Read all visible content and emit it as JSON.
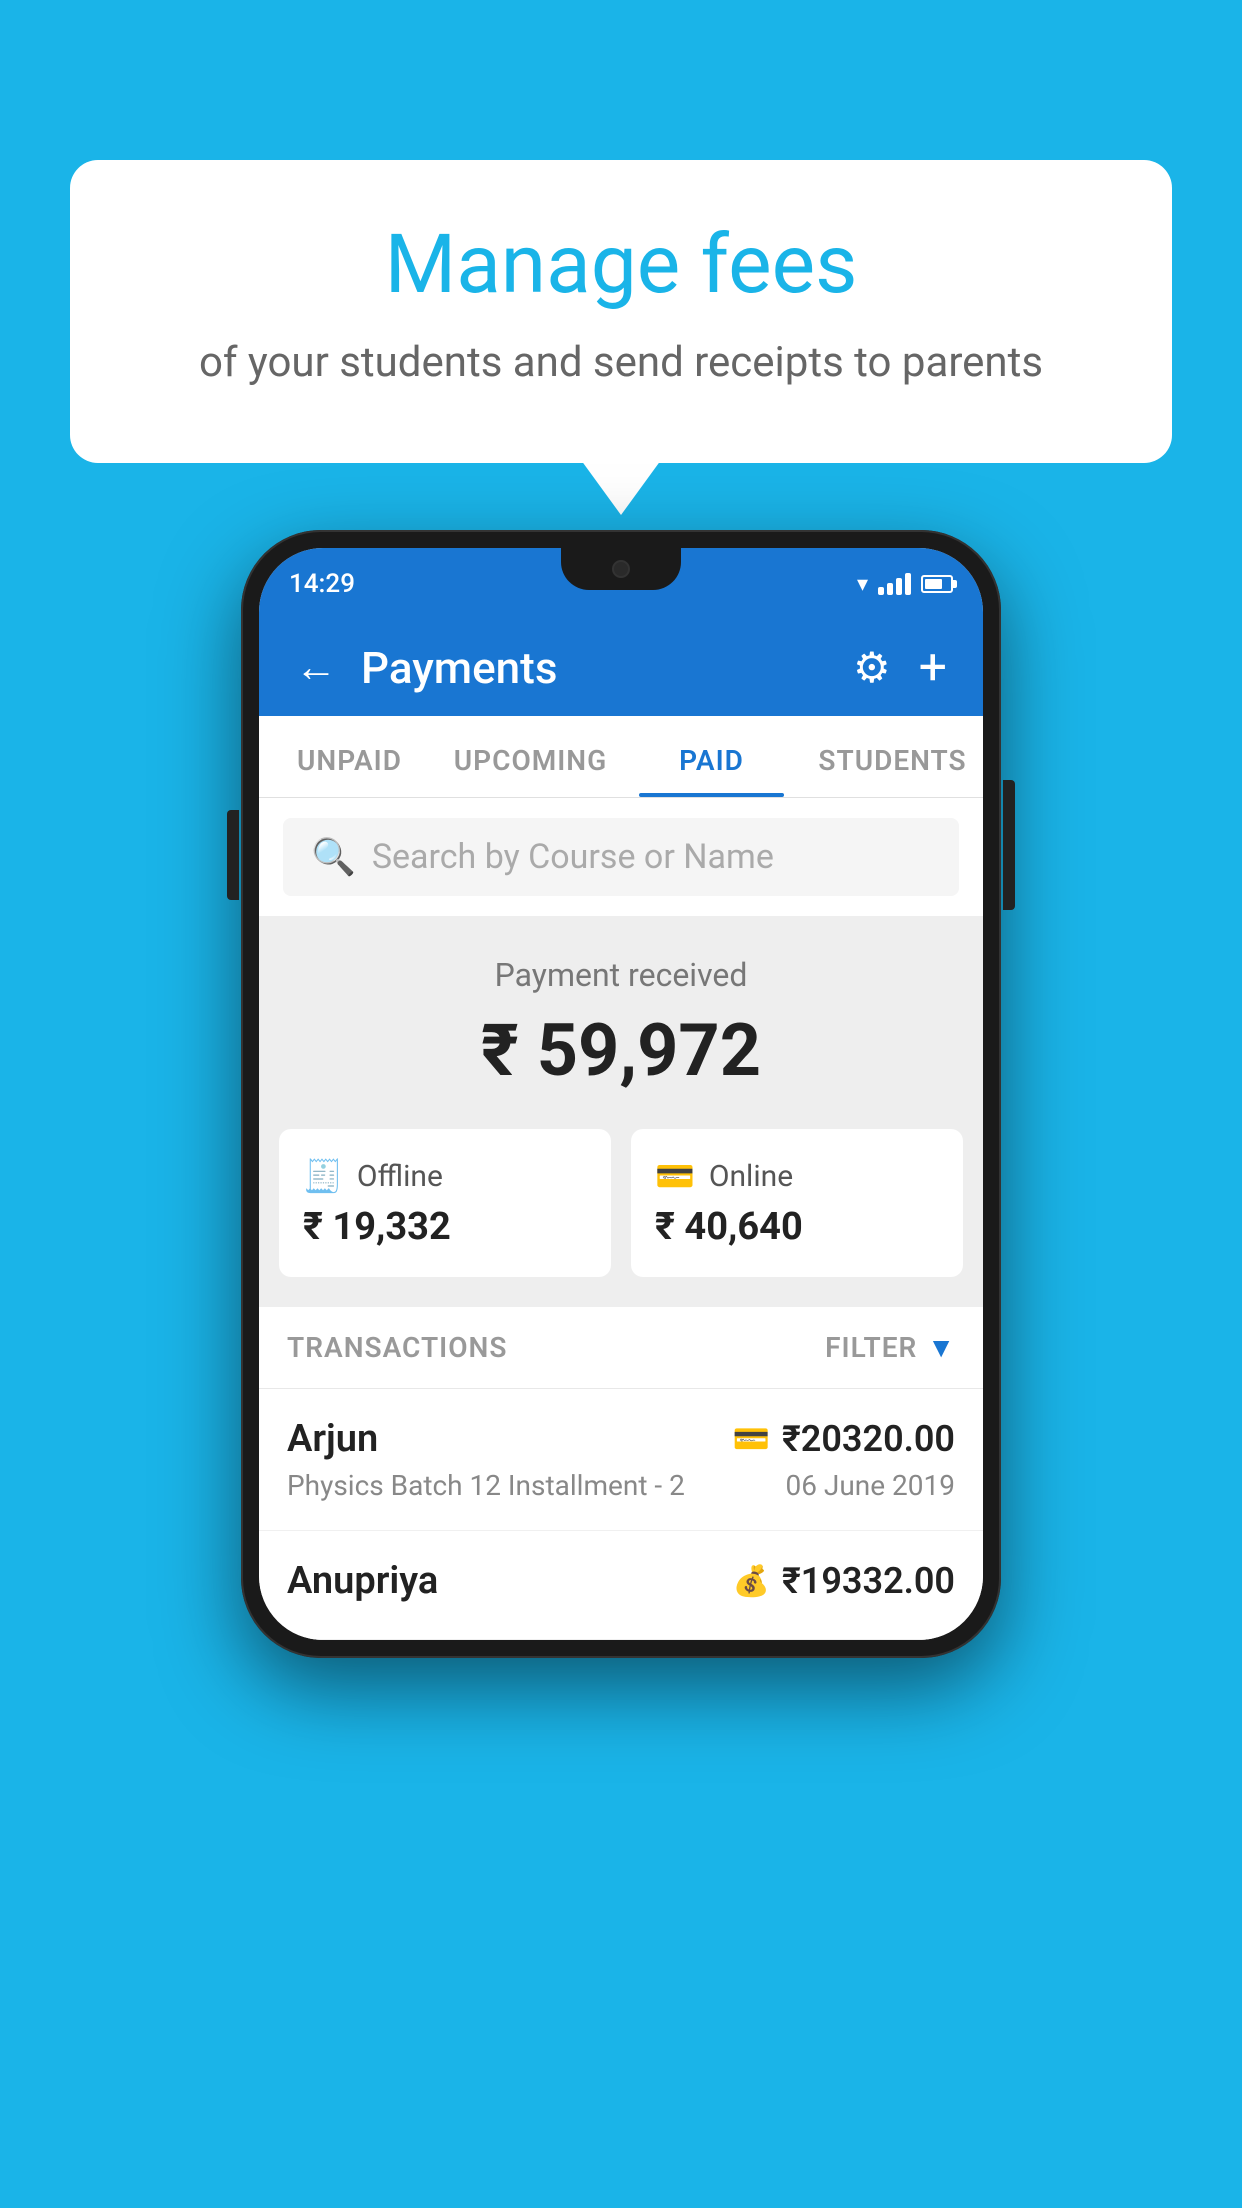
{
  "background_color": "#1ab4e8",
  "bubble": {
    "title": "Manage fees",
    "subtitle": "of your students and send receipts to parents"
  },
  "phone": {
    "status_bar": {
      "time": "14:29"
    },
    "header": {
      "title": "Payments",
      "back_label": "←",
      "gear_label": "⚙",
      "plus_label": "+"
    },
    "tabs": [
      {
        "label": "UNPAID",
        "active": false
      },
      {
        "label": "UPCOMING",
        "active": false
      },
      {
        "label": "PAID",
        "active": true
      },
      {
        "label": "STUDENTS",
        "active": false
      }
    ],
    "search": {
      "placeholder": "Search by Course or Name"
    },
    "payment_received": {
      "label": "Payment received",
      "amount": "₹ 59,972"
    },
    "payment_cards": [
      {
        "icon": "💳",
        "label": "Offline",
        "amount": "₹ 19,332"
      },
      {
        "icon": "💳",
        "label": "Online",
        "amount": "₹ 40,640"
      }
    ],
    "transactions_header": {
      "label": "TRANSACTIONS",
      "filter_label": "FILTER"
    },
    "transactions": [
      {
        "name": "Arjun",
        "detail": "Physics Batch 12 Installment - 2",
        "amount": "₹20320.00",
        "date": "06 June 2019",
        "icon": "💳"
      },
      {
        "name": "Anupriya",
        "detail": "",
        "amount": "₹19332.00",
        "date": "",
        "icon": "💰"
      }
    ]
  }
}
